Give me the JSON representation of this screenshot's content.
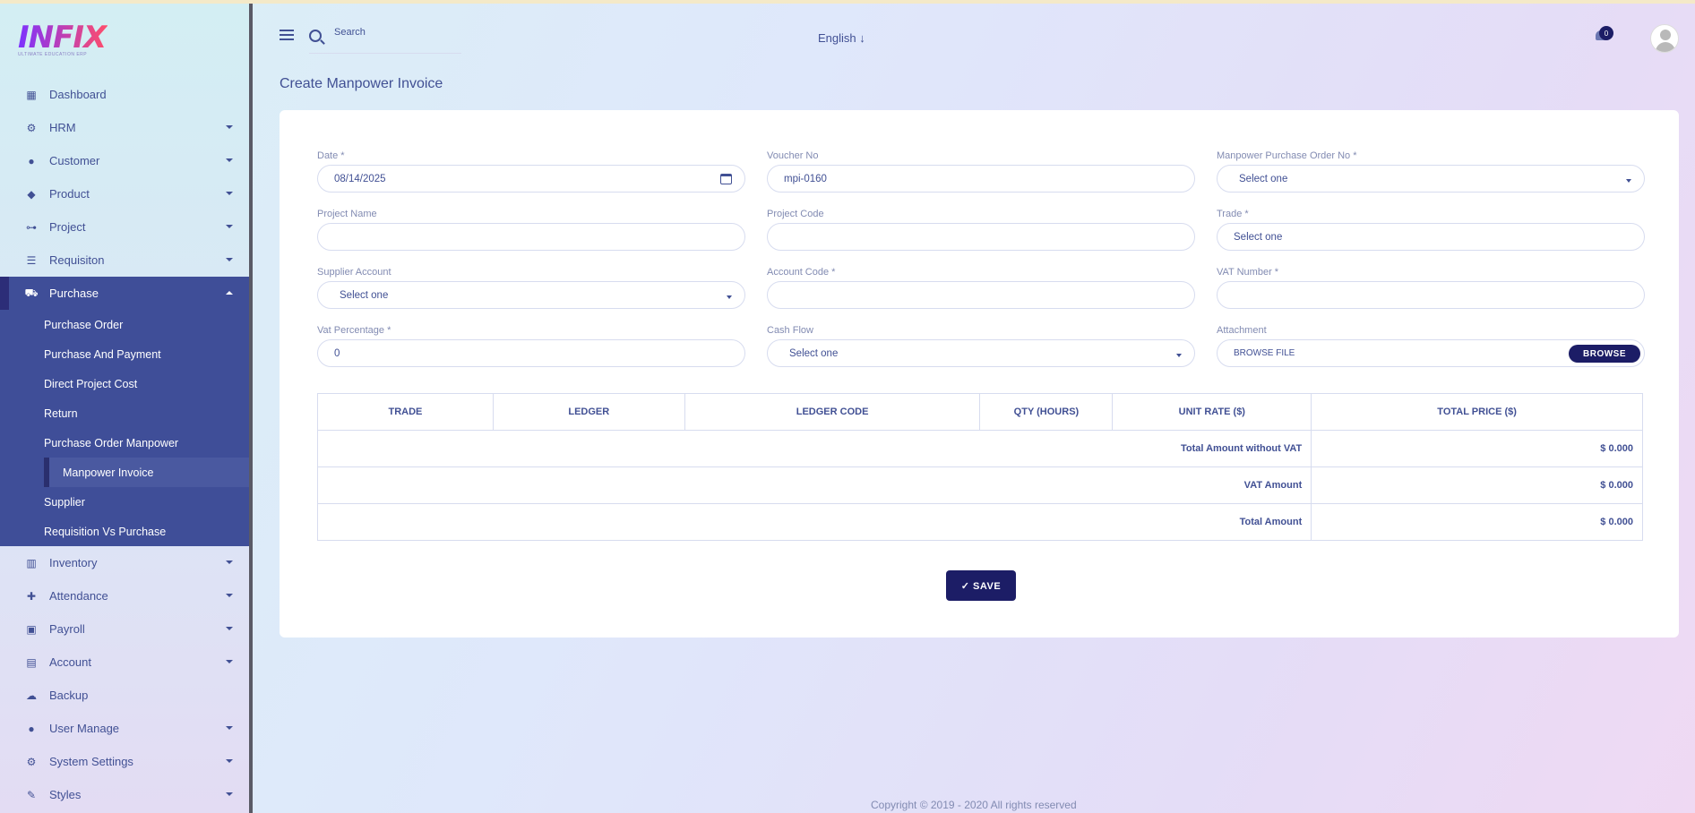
{
  "app": {
    "logo": "INFIX",
    "tagline": "ULTIMATE EDUCATION ERP"
  },
  "sidebar": {
    "items": [
      {
        "label": "Dashboard",
        "icon": "grid-icon"
      },
      {
        "label": "HRM",
        "icon": "users-cog-icon"
      },
      {
        "label": "Customer",
        "icon": "user-icon"
      },
      {
        "label": "Product",
        "icon": "tag-icon"
      },
      {
        "label": "Project",
        "icon": "project-diagram-icon"
      },
      {
        "label": "Requisiton",
        "icon": "list-icon"
      },
      {
        "label": "Purchase",
        "icon": "cart-icon"
      },
      {
        "label": "Inventory",
        "icon": "barcode-icon"
      },
      {
        "label": "Attendance",
        "icon": "user-plus-icon"
      },
      {
        "label": "Payroll",
        "icon": "money-icon"
      },
      {
        "label": "Account",
        "icon": "calculator-icon"
      },
      {
        "label": "Backup",
        "icon": "cloud-icon"
      },
      {
        "label": "User Manage",
        "icon": "users-icon"
      },
      {
        "label": "System Settings",
        "icon": "gear-icon"
      },
      {
        "label": "Styles",
        "icon": "brush-icon"
      }
    ],
    "purchase_sub": [
      "Purchase Order",
      "Purchase And Payment",
      "Direct Project Cost",
      "Return",
      "Purchase Order Manpower",
      "Manpower Invoice",
      "Supplier",
      "Requisition Vs Purchase"
    ]
  },
  "header": {
    "search_placeholder": "Search",
    "language": "English ↓",
    "notification_count": "0"
  },
  "page": {
    "title": "Create Manpower Invoice"
  },
  "form": {
    "date": {
      "label": "Date *",
      "value": "08/14/2025"
    },
    "voucher": {
      "label": "Voucher No",
      "value": "mpi-0160"
    },
    "po_no": {
      "label": "Manpower Purchase Order No *",
      "value": "Select one"
    },
    "project_name": {
      "label": "Project Name",
      "value": ""
    },
    "project_code": {
      "label": "Project Code",
      "value": ""
    },
    "trade": {
      "label": "Trade *",
      "value": "Select one"
    },
    "supplier_account": {
      "label": "Supplier Account",
      "value": "Select one"
    },
    "account_code": {
      "label": "Account Code *",
      "value": ""
    },
    "vat_number": {
      "label": "VAT Number *",
      "value": ""
    },
    "vat_percentage": {
      "label": "Vat Percentage *",
      "value": "0"
    },
    "cash_flow": {
      "label": "Cash Flow",
      "value": "Select one"
    },
    "attachment": {
      "label": "Attachment",
      "value": "BROWSE FILE",
      "button": "BROWSE"
    }
  },
  "table": {
    "headers": [
      "TRADE",
      "LEDGER",
      "LEDGER CODE",
      "QTY (HOURS)",
      "UNIT RATE ($)",
      "TOTAL PRICE ($)"
    ],
    "summary": [
      {
        "label": "Total Amount without VAT",
        "value": "$ 0.000"
      },
      {
        "label": "VAT Amount",
        "value": "$ 0.000"
      },
      {
        "label": "Total Amount",
        "value": "$ 0.000"
      }
    ]
  },
  "save_label": "✓ SAVE",
  "footer": "Copyright © 2019 - 2020 All rights reserved",
  "colors": {
    "primary": "#415094",
    "dark_button": "#1c1d66",
    "active_nav": "#3f4e98"
  }
}
